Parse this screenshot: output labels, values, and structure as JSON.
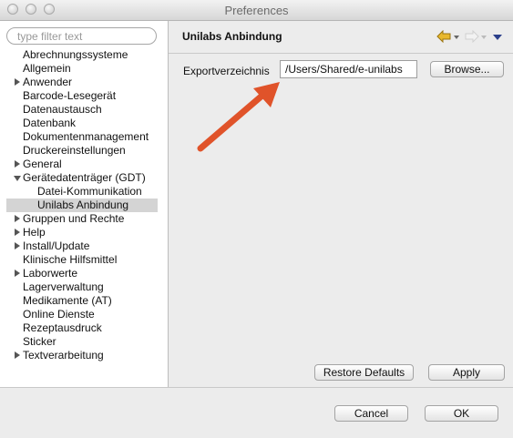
{
  "window": {
    "title": "Preferences"
  },
  "sidebar": {
    "filter_placeholder": "type filter text",
    "items": [
      {
        "label": "Abrechnungssysteme",
        "expander": "none",
        "level": 0
      },
      {
        "label": "Allgemein",
        "expander": "none",
        "level": 0
      },
      {
        "label": "Anwender",
        "expander": "collapsed",
        "level": 0
      },
      {
        "label": "Barcode-Lesegerät",
        "expander": "none",
        "level": 0
      },
      {
        "label": "Datenaustausch",
        "expander": "none",
        "level": 0
      },
      {
        "label": "Datenbank",
        "expander": "none",
        "level": 0
      },
      {
        "label": "Dokumentenmanagement",
        "expander": "none",
        "level": 0
      },
      {
        "label": "Druckereinstellungen",
        "expander": "none",
        "level": 0
      },
      {
        "label": "General",
        "expander": "collapsed",
        "level": 0
      },
      {
        "label": "Gerätedatenträger (GDT)",
        "expander": "expanded",
        "level": 0
      },
      {
        "label": "Datei-Kommunikation",
        "expander": "none",
        "level": 1
      },
      {
        "label": "Unilabs Anbindung",
        "expander": "none",
        "level": 1,
        "selected": true
      },
      {
        "label": "Gruppen und Rechte",
        "expander": "collapsed",
        "level": 0
      },
      {
        "label": "Help",
        "expander": "collapsed",
        "level": 0
      },
      {
        "label": "Install/Update",
        "expander": "collapsed",
        "level": 0
      },
      {
        "label": "Klinische Hilfsmittel",
        "expander": "none",
        "level": 0
      },
      {
        "label": "Laborwerte",
        "expander": "collapsed",
        "level": 0
      },
      {
        "label": "Lagerverwaltung",
        "expander": "none",
        "level": 0
      },
      {
        "label": "Medikamente (AT)",
        "expander": "none",
        "level": 0
      },
      {
        "label": "Online Dienste",
        "expander": "none",
        "level": 0
      },
      {
        "label": "Rezeptausdruck",
        "expander": "none",
        "level": 0
      },
      {
        "label": "Sticker",
        "expander": "none",
        "level": 0
      },
      {
        "label": "Textverarbeitung",
        "expander": "collapsed",
        "level": 0
      }
    ]
  },
  "main": {
    "title": "Unilabs Anbindung",
    "export_label": "Exportverzeichnis",
    "export_value": "/Users/Shared/e-unilabs",
    "browse_label": "Browse...",
    "restore_label": "Restore Defaults",
    "apply_label": "Apply"
  },
  "footer": {
    "cancel_label": "Cancel",
    "ok_label": "OK"
  },
  "colors": {
    "annotation_arrow": "#e0532a",
    "back_arrow": "#e8b82e",
    "view_menu": "#2b3f8a"
  },
  "icons": [
    "back-arrow-icon",
    "forward-arrow-icon",
    "view-menu-icon",
    "annotation-arrow"
  ]
}
